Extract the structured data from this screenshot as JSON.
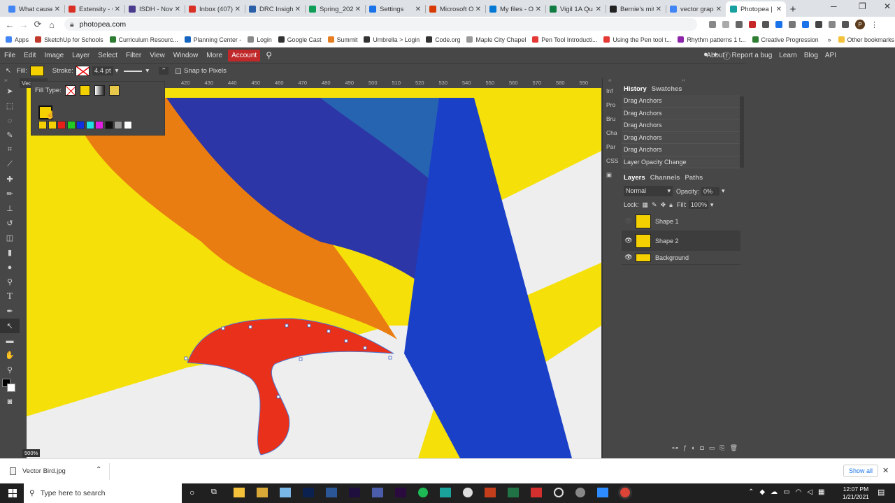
{
  "tabs": [
    {
      "title": "What cause",
      "color": "#4285f4"
    },
    {
      "title": "Extensity - C",
      "color": "#d93025"
    },
    {
      "title": "ISDH - Nove",
      "color": "#4a3b8c"
    },
    {
      "title": "Inbox (407)",
      "color": "#d93025"
    },
    {
      "title": "DRC Insight",
      "color": "#2b5fa8"
    },
    {
      "title": "Spring_2021",
      "color": "#0f9d58"
    },
    {
      "title": "Settings",
      "color": "#1a73e8"
    },
    {
      "title": "Microsoft O",
      "color": "#d83b01"
    },
    {
      "title": "My files - O",
      "color": "#0078d4"
    },
    {
      "title": "Vigil 1A Qu",
      "color": "#107c41"
    },
    {
      "title": "Bernie's mit",
      "color": "#222222"
    },
    {
      "title": "vector grap",
      "color": "#4285f4"
    },
    {
      "title": "Photopea |",
      "color": "#18a0a0",
      "active": true
    }
  ],
  "address": {
    "url": "photopea.com"
  },
  "bookmarks": [
    {
      "label": "Apps",
      "color": "#4285f4"
    },
    {
      "label": "SketchUp for Schools",
      "color": "#c0392b"
    },
    {
      "label": "Curriculum Resourc...",
      "color": "#2e7d32"
    },
    {
      "label": "Planning Center -",
      "color": "#1565c0"
    },
    {
      "label": "Login",
      "color": "#888888"
    },
    {
      "label": "Google Cast",
      "color": "#333333"
    },
    {
      "label": "Summit",
      "color": "#e67e22"
    },
    {
      "label": "Umbrella > Login",
      "color": "#333333"
    },
    {
      "label": "Code.org",
      "color": "#333333"
    },
    {
      "label": "Maple City Chapel",
      "color": "#999999"
    },
    {
      "label": "Pen Tool Introducti...",
      "color": "#e53935"
    },
    {
      "label": "Using the Pen tool t...",
      "color": "#e53935"
    },
    {
      "label": "Rhythm patterns 1 t...",
      "color": "#8e24aa"
    },
    {
      "label": "Creative Progression",
      "color": "#2e7d32"
    }
  ],
  "bookmarks_more": "»",
  "other_bookmarks": "Other bookmarks",
  "menu": {
    "items": [
      "File",
      "Edit",
      "Image",
      "Layer",
      "Select",
      "Filter",
      "View",
      "Window",
      "More"
    ],
    "account": "Account",
    "right": [
      "About",
      "Report a bug",
      "Learn",
      "Blog",
      "API"
    ]
  },
  "options": {
    "fill_label": "Fill:",
    "stroke_label": "Stroke:",
    "stroke_width": "4.4 pt",
    "snap_label": "Snap to Pixels",
    "fill_color": "#f4d000"
  },
  "fill_popup": {
    "label": "Fill Type:",
    "swatches": [
      "#f4d000",
      "#f4d000",
      "#e8201a",
      "#22cc22",
      "#1030e0",
      "#20e0e0",
      "#e020e0",
      "#111111",
      "#999999",
      "#ffffff"
    ]
  },
  "canvas": {
    "doc_tab": "Vec",
    "ruler": [
      "420",
      "430",
      "440",
      "450",
      "460",
      "470",
      "480",
      "490",
      "500",
      "510",
      "520",
      "530",
      "540",
      "550",
      "560",
      "570",
      "580",
      "590"
    ],
    "zoom": "500%"
  },
  "side_tabs": [
    "Inf",
    "Pro",
    "Bru",
    "Cha",
    "Par",
    "CSS"
  ],
  "history": {
    "tabs": [
      "History",
      "Swatches"
    ],
    "items": [
      "Drag Anchors",
      "Drag Anchors",
      "Drag Anchors",
      "Drag Anchors",
      "Drag Anchors",
      "Layer Opacity Change"
    ]
  },
  "layers": {
    "tabs": [
      "Layers",
      "Channels",
      "Paths"
    ],
    "blend": "Normal",
    "opacity_label": "Opacity:",
    "opacity": "0%",
    "lock_label": "Lock:",
    "fill_label": "Fill:",
    "fill": "100%",
    "items": [
      {
        "name": "Shape 1",
        "visible": false
      },
      {
        "name": "Shape 2",
        "visible": true
      },
      {
        "name": "Background",
        "visible": true
      }
    ]
  },
  "download": {
    "file": "Vector Bird.jpg",
    "show_all": "Show all"
  },
  "taskbar": {
    "search": "Type here to search",
    "time": "12:07 PM",
    "date": "1/21/2021"
  }
}
